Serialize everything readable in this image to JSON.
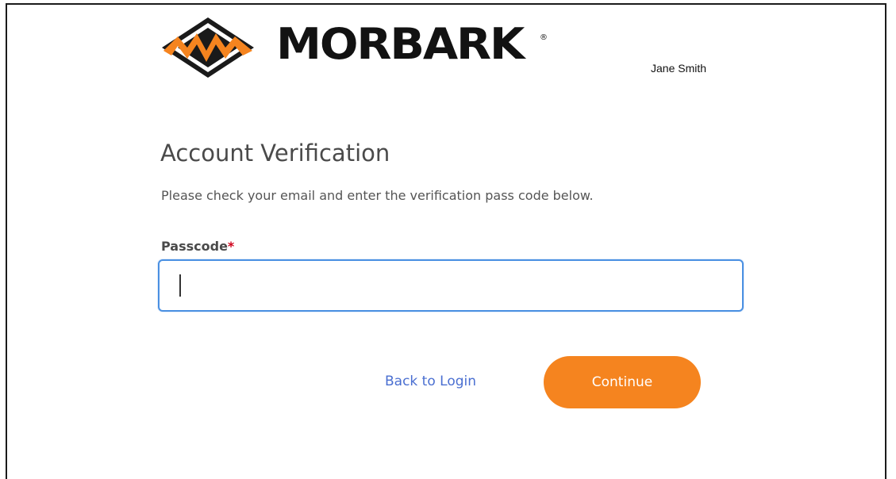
{
  "brand": {
    "name": "MORBARK",
    "registered_mark": "®",
    "logo_icon": "morbark-diamond-logo-icon",
    "accent_color": "#f5841f"
  },
  "header": {
    "user_name": "Jane Smith"
  },
  "main": {
    "title": "Account Verification",
    "instructions": "Please check your email and enter the verification pass code below.",
    "passcode": {
      "label": "Passcode",
      "required_marker": "*",
      "value": "",
      "placeholder": ""
    },
    "actions": {
      "back_label": "Back to Login",
      "continue_label": "Continue"
    }
  },
  "colors": {
    "input_focus_border": "#4a90e2",
    "link": "#4a6fd1",
    "required": "#d0021b"
  }
}
